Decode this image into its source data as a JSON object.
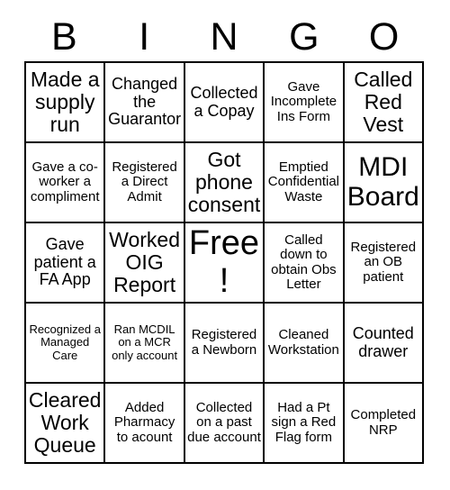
{
  "card": {
    "title": "BINGO",
    "header_letters": [
      "B",
      "I",
      "N",
      "G",
      "O"
    ],
    "columns": 5,
    "rows": 5,
    "border_color": "#000000",
    "background_color": "#ffffff",
    "text_color": "#000000",
    "cells": [
      {
        "text": "Made a supply run",
        "size": "lg",
        "free": false
      },
      {
        "text": "Changed the Guarantor",
        "size": "md",
        "free": false
      },
      {
        "text": "Collected a Copay",
        "size": "md",
        "free": false
      },
      {
        "text": "Gave Incomplete Ins Form",
        "size": "sm",
        "free": false
      },
      {
        "text": "Called Red Vest",
        "size": "lg",
        "free": false
      },
      {
        "text": "Gave a co-worker a compliment",
        "size": "sm",
        "free": false
      },
      {
        "text": "Registered a Direct Admit",
        "size": "sm",
        "free": false
      },
      {
        "text": "Got phone consent",
        "size": "lg",
        "free": false
      },
      {
        "text": "Emptied Confidential Waste",
        "size": "sm",
        "free": false
      },
      {
        "text": "MDI Board",
        "size": "xl",
        "free": false
      },
      {
        "text": "Gave patient a FA App",
        "size": "md",
        "free": false
      },
      {
        "text": "Worked OIG Report",
        "size": "lg",
        "free": false
      },
      {
        "text": "Free!",
        "size": "free",
        "free": true
      },
      {
        "text": "Called down to obtain Obs Letter",
        "size": "sm",
        "free": false
      },
      {
        "text": "Registered an OB patient",
        "size": "sm",
        "free": false
      },
      {
        "text": "Recognized a Managed Care",
        "size": "xs",
        "free": false
      },
      {
        "text": "Ran MCDIL on a MCR only account",
        "size": "xs",
        "free": false
      },
      {
        "text": "Registered a Newborn",
        "size": "sm",
        "free": false
      },
      {
        "text": "Cleaned Workstation",
        "size": "sm",
        "free": false
      },
      {
        "text": "Counted drawer",
        "size": "md",
        "free": false
      },
      {
        "text": "Cleared Work Queue",
        "size": "lg",
        "free": false
      },
      {
        "text": "Added Pharmacy to acount",
        "size": "sm",
        "free": false
      },
      {
        "text": "Collected on a past due account",
        "size": "sm",
        "free": false
      },
      {
        "text": "Had a Pt sign a Red Flag form",
        "size": "sm",
        "free": false
      },
      {
        "text": "Completed NRP",
        "size": "sm",
        "free": false
      }
    ]
  }
}
